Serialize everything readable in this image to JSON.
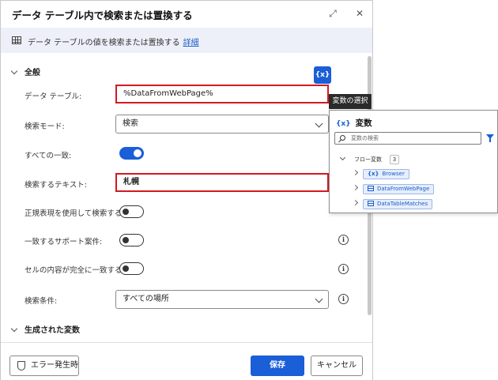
{
  "dialog": {
    "title": "データ テーブル内で検索または置換する",
    "expand_icon": "⤢",
    "close_icon": "✕",
    "info_text": "データ テーブルの値を検索または置換する",
    "info_link": "詳細"
  },
  "sections": {
    "general": "全般",
    "generated_vars": "生成された変数"
  },
  "fields": {
    "data_table_label": "データ テーブル:",
    "data_table_value": "%DataFromWebPage%",
    "search_mode_label": "検索モード:",
    "search_mode_value": "検索",
    "all_match_label": "すべての一致:",
    "all_match_on": true,
    "search_text_label": "検索するテキスト:",
    "search_text_value": "札幌",
    "regex_label": "正規表現を使用して検索する:",
    "regex_on": false,
    "match_case_label": "一致するサポート案件:",
    "match_case_on": false,
    "exact_cell_label": "セルの内容が完全に一致する:",
    "exact_cell_on": false,
    "search_by_label": "検索条件:",
    "search_by_value": "すべての場所"
  },
  "footer": {
    "on_error": "エラー発生時",
    "save": "保存",
    "cancel": "キャンセル"
  },
  "variable_picker": {
    "badge": "{x}",
    "tooltip": "変数の選択",
    "header_icon": "{x}",
    "header": "変数",
    "search_placeholder": "変数の検索",
    "group_label": "フロー変数",
    "group_count": "3",
    "items": [
      {
        "name": "Browser",
        "type_icon": "{x}"
      },
      {
        "name": "DataFromWebPage",
        "type_icon": "table-icon"
      },
      {
        "name": "DataTableMatches",
        "type_icon": "table-icon"
      }
    ]
  },
  "colors": {
    "accent": "#1a5ed8",
    "highlight_border": "#d21a20",
    "info_bar": "#eef0f9"
  }
}
